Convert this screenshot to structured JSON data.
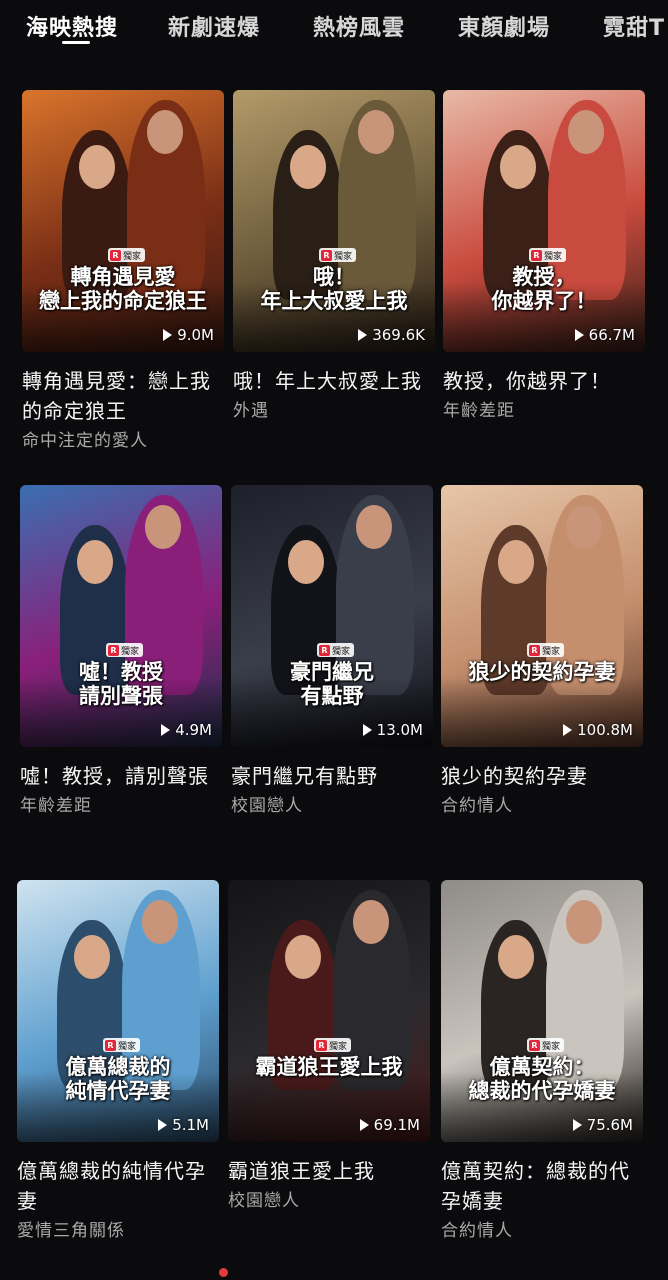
{
  "tabs": [
    {
      "label": "海映熱搜",
      "active": true
    },
    {
      "label": "新劇速爆",
      "active": false
    },
    {
      "label": "熱榜風雲",
      "active": false
    },
    {
      "label": "東顏劇場",
      "active": false
    },
    {
      "label": "霓甜T",
      "active": false
    }
  ],
  "badge_label": "獨家",
  "badge_r": "R",
  "cards": [
    {
      "title": "轉角遇見愛：戀上我的命定狼王",
      "tag": "命中注定的愛人",
      "views": "9.0M",
      "poster_text": "轉角遇見愛\n戀上我的命定狼王",
      "colors": [
        "#7a2e16",
        "#d9742c",
        "#3b1a12"
      ]
    },
    {
      "title": "哦！年上大叔愛上我",
      "tag": "外遇",
      "views": "369.6K",
      "poster_text": "哦！\n年上大叔愛上我",
      "colors": [
        "#6b5a3a",
        "#b39a6a",
        "#2a1f16"
      ]
    },
    {
      "title": "教授，你越界了！",
      "tag": "年齡差距",
      "views": "66.7M",
      "poster_text": "教授，\n你越界了！",
      "colors": [
        "#c94a3e",
        "#e8b9a6",
        "#3b2018"
      ]
    },
    {
      "title": "噓！教授，請別聲張",
      "tag": "年齡差距",
      "views": "4.9M",
      "poster_text": "噓！教授\n請別聲張",
      "colors": [
        "#8a1f7a",
        "#3a6fb0",
        "#1f2f4a"
      ]
    },
    {
      "title": "豪門繼兄有點野",
      "tag": "校園戀人",
      "views": "13.0M",
      "poster_text": "豪門繼兄\n有點野",
      "colors": [
        "#3a3e4a",
        "#1d1f2a",
        "#121219"
      ]
    },
    {
      "title": "狼少的契約孕妻",
      "tag": "合約情人",
      "views": "100.8M",
      "poster_text": "狼少的契約孕妻",
      "colors": [
        "#c58f6e",
        "#e6c6a8",
        "#5e3a2a"
      ]
    },
    {
      "title": "億萬總裁的純情代孕妻",
      "tag": "愛情三角關係",
      "views": "5.1M",
      "poster_text": "億萬總裁的\n純情代孕妻",
      "colors": [
        "#5e9fcf",
        "#cfe3ef",
        "#2c4d6b"
      ]
    },
    {
      "title": "霸道狼王愛上我",
      "tag": "校園戀人",
      "views": "69.1M",
      "poster_text": "霸道狼王愛上我",
      "colors": [
        "#2a2a2e",
        "#141416",
        "#4a1a1a"
      ]
    },
    {
      "title": "億萬契約：總裁的代孕嬌妻",
      "tag": "合約情人",
      "views": "75.6M",
      "poster_text": "億萬契約：\n總裁的代孕嬌妻",
      "colors": [
        "#c9c4bd",
        "#8f8b86",
        "#2a2522"
      ]
    }
  ]
}
